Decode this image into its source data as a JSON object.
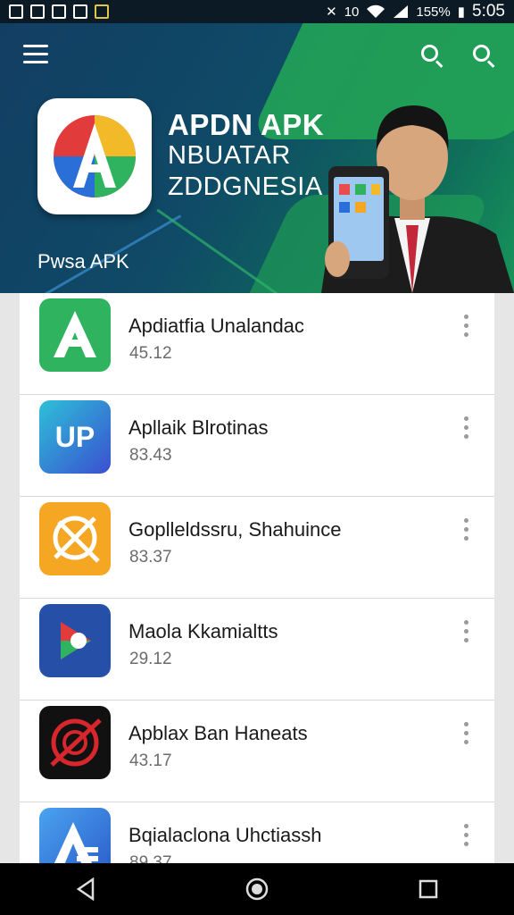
{
  "status_bar": {
    "battery": "155%",
    "time": "5:05",
    "signal_glyph": "10"
  },
  "banner": {
    "title_line1": "APDN APK",
    "title_line2": "NBUATAR",
    "title_line3": "ZDDGNESIA",
    "subtitle": "Pwsa APK"
  },
  "apps": [
    {
      "name": "Apdiatfia Unalandac",
      "value": "45.12",
      "icon": "green-a-icon",
      "color": "#2fb35e"
    },
    {
      "name": "Apllaik Blrotinas",
      "value": "83.43",
      "icon": "up-badge-icon",
      "color": "#2a9fd8"
    },
    {
      "name": "Goplleldssru, Shahuince",
      "value": "83.37",
      "icon": "compass-wrench-icon",
      "color": "#f5a623"
    },
    {
      "name": "Maola Kkamialtts",
      "value": "29.12",
      "icon": "play-d-icon",
      "color": "#2650a8"
    },
    {
      "name": "Apblax Ban Haneats",
      "value": "43.17",
      "icon": "target-slash-icon",
      "color": "#111111"
    },
    {
      "name": "Bqialaclona Uhctiassh",
      "value": "89.37",
      "icon": "blue-a-icon",
      "color": "#3a7fd8"
    }
  ],
  "nav": {
    "back": "back-icon",
    "home": "home-icon",
    "recents": "recents-icon"
  }
}
